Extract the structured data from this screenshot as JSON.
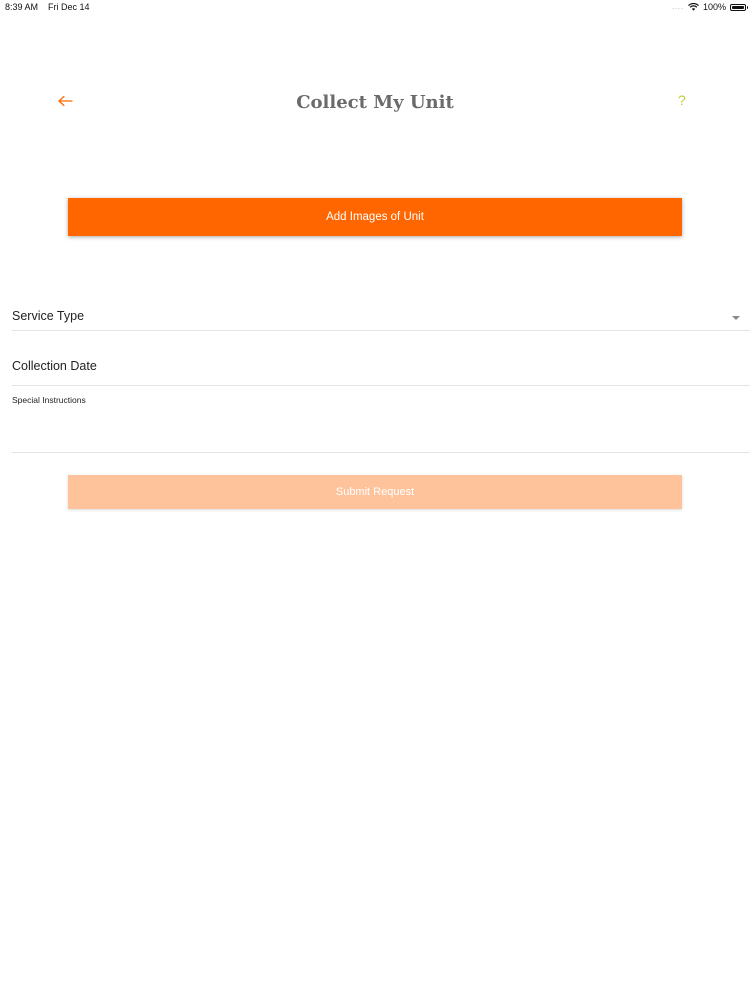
{
  "status_bar": {
    "time": "8:39 AM",
    "date": "Fri Dec 14",
    "signal": "....",
    "battery_percent": "100%",
    "battery_level": 1.0
  },
  "header": {
    "title": "Collect My Unit",
    "back_icon": "back-arrow-icon",
    "help_icon": "question-mark-icon",
    "help_symbol": "?"
  },
  "actions": {
    "add_images_label": "Add Images of Unit",
    "submit_label": "Submit Request"
  },
  "form": {
    "service_type_label": "Service Type",
    "collection_date_label": "Collection Date",
    "special_instructions_label": "Special Instructions",
    "special_instructions_value": ""
  },
  "colors": {
    "accent": "#ff6600",
    "accent_disabled": "#ffc39b",
    "title": "#6a6a6a",
    "help": "#c2cc3a"
  }
}
